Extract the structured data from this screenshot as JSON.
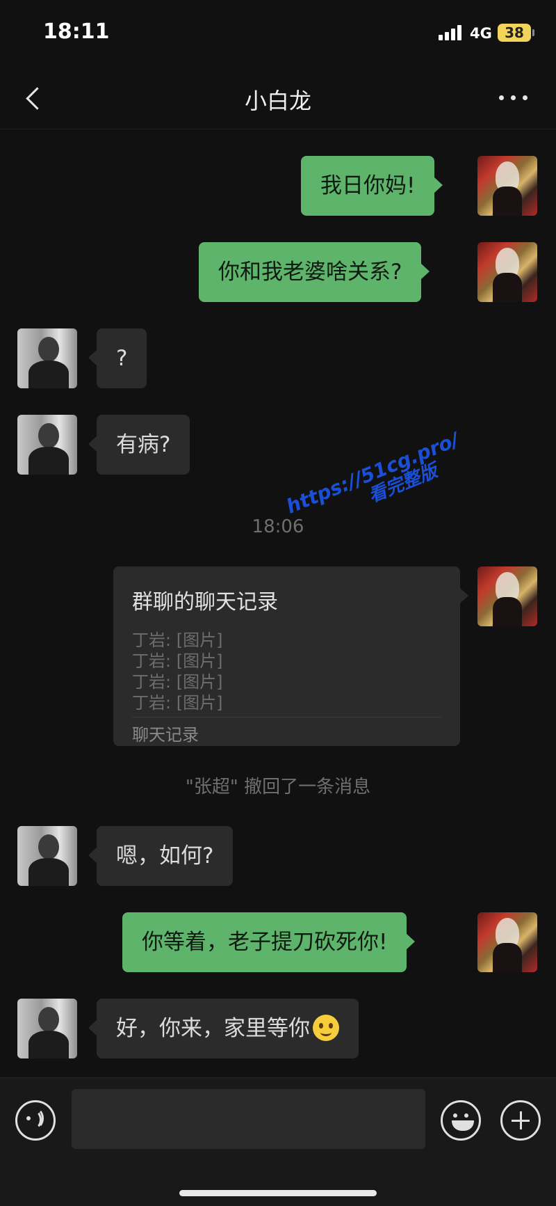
{
  "status_bar": {
    "time": "18:11",
    "network": "4G",
    "battery": "38",
    "battery_color": "#f2d45b"
  },
  "nav": {
    "title": "小白龙",
    "back_icon": "chevron-left-icon",
    "more_icon": "more-dots-icon"
  },
  "messages": [
    {
      "sender": "self",
      "text": "我日你妈!"
    },
    {
      "sender": "self",
      "text": "你和我老婆啥关系?"
    },
    {
      "sender": "other",
      "text": "?"
    },
    {
      "sender": "other",
      "text": "有病?"
    }
  ],
  "timestamp": "18:06",
  "chat_record": {
    "title": "群聊的聊天记录",
    "lines": [
      "丁岩: [图片]",
      "丁岩: [图片]",
      "丁岩: [图片]",
      "丁岩: [图片]"
    ],
    "footer": "聊天记录"
  },
  "system_note": "\"张超\" 撤回了一条消息",
  "messages_after": [
    {
      "sender": "other",
      "text": "嗯，如何?"
    },
    {
      "sender": "self",
      "text": "你等着，老子提刀砍死你!"
    },
    {
      "sender": "other",
      "text": "好，你来，家里等你",
      "emoji": "smile-emoji"
    }
  ],
  "watermark": {
    "line1": "https://51cg.pro/",
    "line2": "看完整版"
  },
  "input_bar": {
    "voice_icon": "voice-icon",
    "emoji_icon": "emoji-icon",
    "plus_icon": "plus-icon",
    "input_value": ""
  },
  "colors": {
    "background": "#111111",
    "outgoing_bubble": "#5fb46c",
    "incoming_bubble": "#2b2b2b"
  }
}
